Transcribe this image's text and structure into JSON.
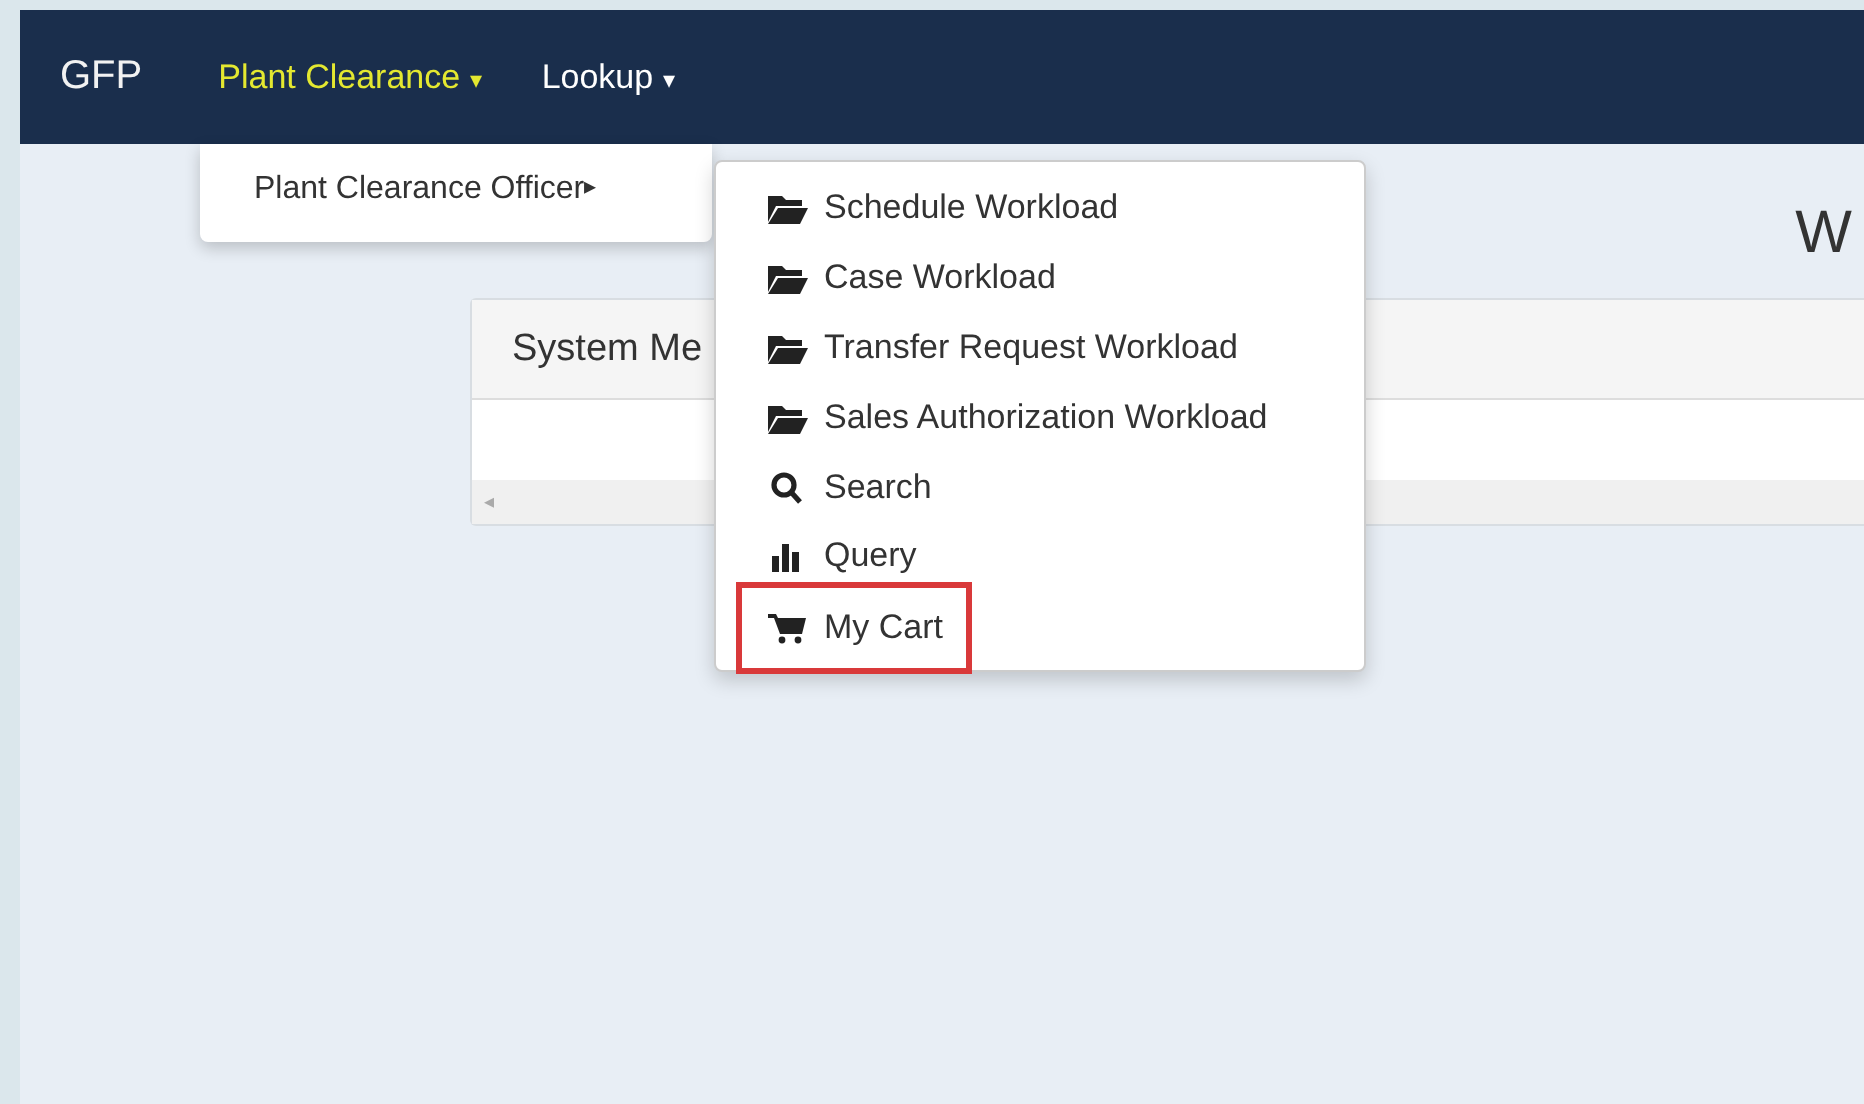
{
  "navbar": {
    "brand": "GFP",
    "menus": [
      {
        "label": "Plant Clearance",
        "caret": "▾",
        "selected": true
      },
      {
        "label": "Lookup",
        "caret": "▾",
        "selected": false
      }
    ]
  },
  "dropdown": {
    "items": [
      {
        "label": "Plant Clearance Officer",
        "arrow": "▸"
      }
    ]
  },
  "submenu": {
    "items": [
      {
        "kind": "folder",
        "label": "Schedule Workload",
        "highlighted": false
      },
      {
        "kind": "folder",
        "label": "Case Workload",
        "highlighted": false
      },
      {
        "kind": "folder",
        "label": "Transfer Request Workload",
        "highlighted": false
      },
      {
        "kind": "folder",
        "label": "Sales Authorization Workload",
        "highlighted": false
      },
      {
        "kind": "search",
        "label": "Search",
        "highlighted": false
      },
      {
        "kind": "chart",
        "label": "Query",
        "highlighted": false
      },
      {
        "kind": "cart",
        "label": "My Cart",
        "highlighted": true
      }
    ]
  },
  "page": {
    "title": "W",
    "panel": {
      "title": "System Me",
      "scroll_arrow": "◂"
    }
  }
}
